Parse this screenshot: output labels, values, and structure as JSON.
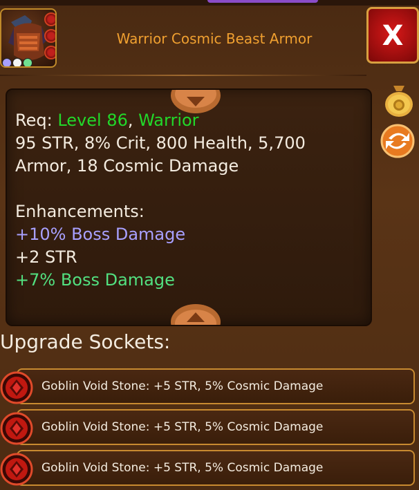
{
  "header": {
    "item_name": "Warrior Cosmic Beast Armor",
    "close_label": "X"
  },
  "stats": {
    "req_prefix": "Req: ",
    "req_level": "Level 86",
    "req_sep": ", ",
    "req_class": "Warrior",
    "line_1": "95 STR, 8% Crit, 800 Health, 5,700",
    "line_2": "Armor, 18 Cosmic Damage",
    "enh_title": "Enhancements:",
    "enhancements": [
      "+10% Boss Damage",
      "+2 STR",
      "+7% Boss Damage"
    ]
  },
  "sockets": {
    "title": "Upgrade Sockets:",
    "items": [
      "Goblin Void Stone: +5 STR, 5% Cosmic Damage",
      "Goblin Void Stone: +5 STR, 5% Cosmic Damage",
      "Goblin Void Stone: +5 STR, 5% Cosmic Damage"
    ]
  },
  "colors": {
    "title": "#f0a030",
    "requirement": "#22d82a",
    "enhancement_purple": "#a8a0ff",
    "enhancement_green": "#52e080"
  },
  "icons": {
    "item": "armor-icon",
    "sell": "gold-bag-icon",
    "swap": "swap-arrows-icon",
    "socket": "red-gem-icon"
  }
}
